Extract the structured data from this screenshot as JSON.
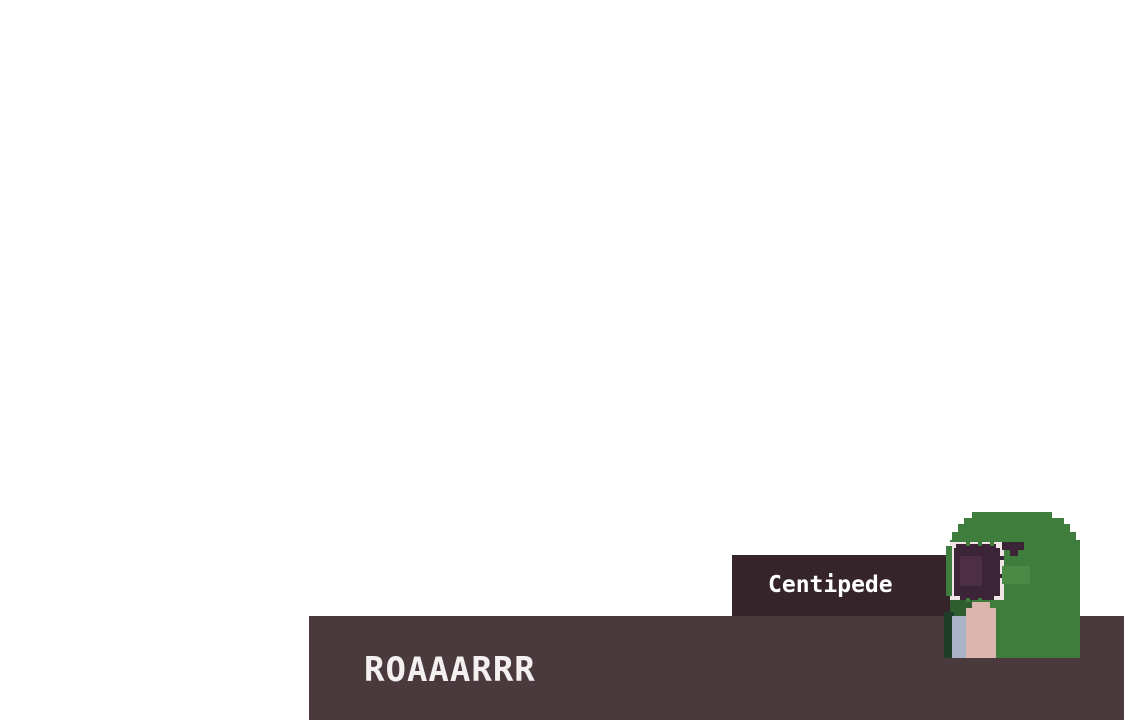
{
  "dialogue": {
    "speaker": "Centipede",
    "text": "ROAAARRR"
  },
  "colors": {
    "dialogue_bg": "#4a3a3e",
    "name_tag_bg": "#35252a",
    "text": "#f4f0f0",
    "creature_green": "#3f7d3c",
    "creature_dark_green": "#2e5e30",
    "mouth": "#3a2436",
    "teeth": "#f0e4e6",
    "belly_pink": "#dbb6ae",
    "belly_blue": "#aab3c8"
  },
  "portrait": {
    "icon": "green-creature-roaring-icon"
  }
}
